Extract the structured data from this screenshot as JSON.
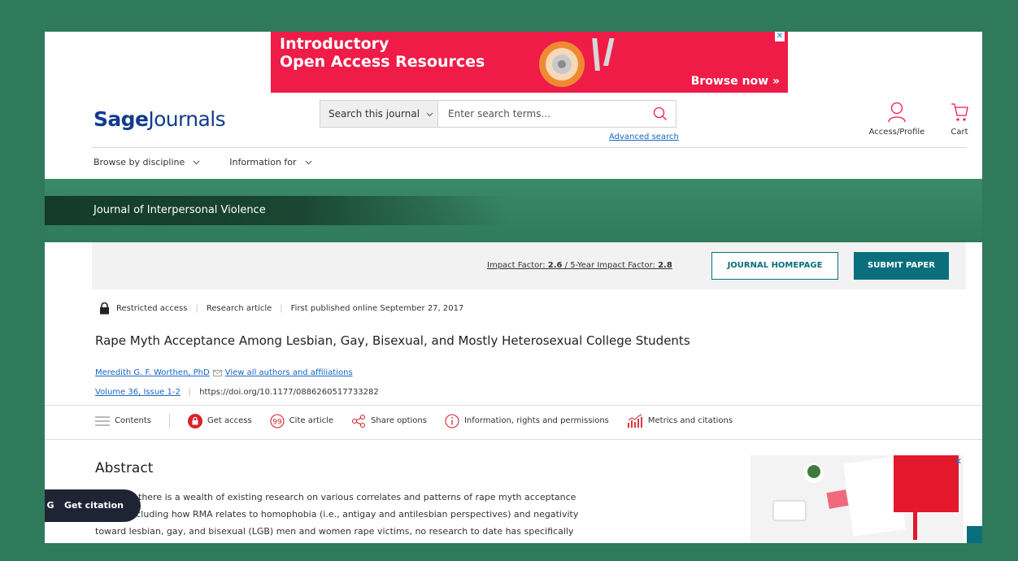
{
  "ad_banner": {
    "title_line1": "Introductory",
    "title_line2": "Open Access Resources",
    "cta": "Browse now »",
    "close": "✕",
    "color": "#ee1c47"
  },
  "header": {
    "logo_bold": "Sage",
    "logo_light": "Journals",
    "search_scope": "Search this journal",
    "search_placeholder": "Enter search terms...",
    "advanced_search": "Advanced search",
    "account_label": "Access/Profile",
    "cart_label": "Cart"
  },
  "nav": {
    "browse": "Browse by discipline",
    "info_for": "Information for"
  },
  "journal": {
    "name": "Journal of Interpersonal Violence",
    "impact_prefix": "Impact Factor: ",
    "impact_value": "2.6",
    "impact_sep": " / ",
    "impact5_prefix": "5-Year Impact Factor: ",
    "impact5_value": "2.8",
    "homepage_btn": "JOURNAL HOMEPAGE",
    "submit_btn": "SUBMIT PAPER",
    "brand_color": "#0a6f7c",
    "hero_color": "#2f7a59"
  },
  "article": {
    "access": "Restricted access",
    "type": "Research article",
    "published": "First published online September 27, 2017",
    "title": "Rape Myth Acceptance Among Lesbian, Gay, Bisexual, and Mostly Heterosexual College Students",
    "author": "Meredith G. F. Worthen, PhD",
    "all_authors": "View all authors and affiliations",
    "volume": "Volume 36, Issue 1-2",
    "doi": "https://doi.org/10.1177/0886260517733282"
  },
  "tools": {
    "contents": "Contents",
    "get_access": "Get access",
    "cite": "Cite article",
    "share": "Share options",
    "info": "Information, rights and permissions",
    "metrics": "Metrics and citations"
  },
  "abstract": {
    "heading": "Abstract",
    "line1": "Although there is a wealth of existing research on various correlates and patterns of rape myth acceptance",
    "line2": "(RMA), including how RMA relates to homophobia (i.e., antigay and antilesbian perspectives) and negativity",
    "line3": "toward lesbian, gay, and bisexual (LGB) men and women rape victims, no research to date has specifically"
  },
  "citation_pill": {
    "logo": "G",
    "label": "Get citation"
  },
  "side_ad": {
    "close": "✕"
  }
}
